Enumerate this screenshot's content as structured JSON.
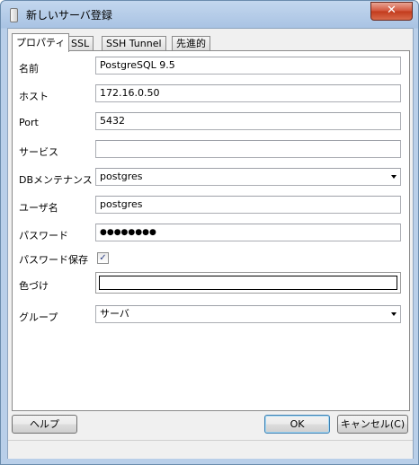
{
  "window": {
    "title": "新しいサーバ登録",
    "close_label": "✕"
  },
  "tabs": [
    {
      "label": "プロパティ"
    },
    {
      "label": "SSL"
    },
    {
      "label": "SSH Tunnel"
    },
    {
      "label": "先進的"
    }
  ],
  "form": {
    "name_label": "名前",
    "name_value": "PostgreSQL 9.5",
    "host_label": "ホスト",
    "host_value": "172.16.0.50",
    "port_label": "Port",
    "port_value": "5432",
    "service_label": "サービス",
    "service_value": "",
    "maintdb_label": "DBメンテナンス",
    "maintdb_value": "postgres",
    "username_label": "ユーザ名",
    "username_value": "postgres",
    "password_label": "パスワード",
    "password_value": "●●●●●●●●",
    "savepw_label": "パスワード保存",
    "savepw_checked": true,
    "savepw_check": "✓",
    "color_label": "色づけ",
    "group_label": "グループ",
    "group_value": "サーバ"
  },
  "buttons": {
    "help": "ヘルプ",
    "ok": "OK",
    "cancel": "キャンセル(C)"
  }
}
